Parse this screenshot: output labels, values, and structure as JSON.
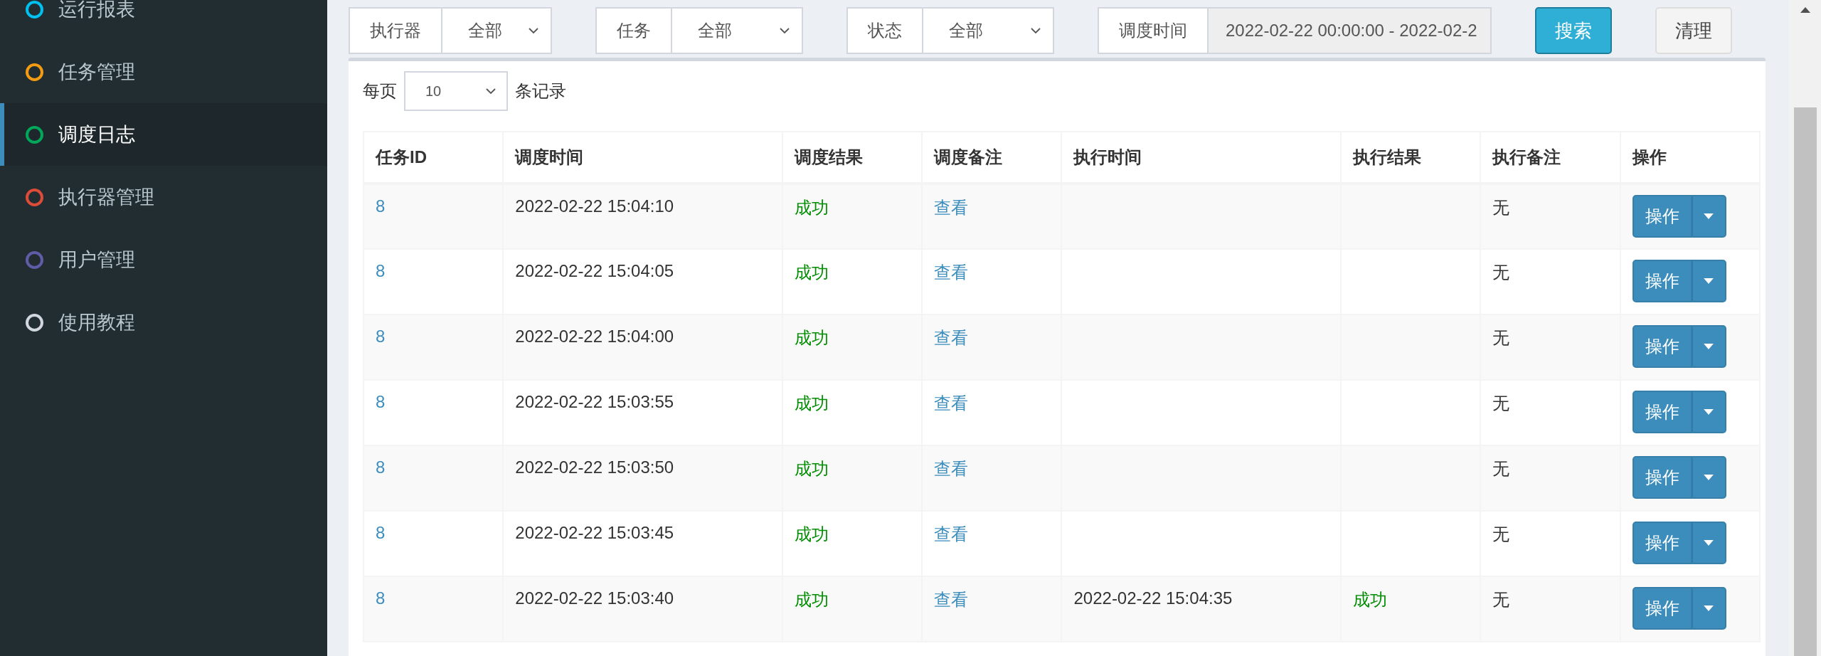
{
  "sidebar": {
    "items": [
      {
        "label": "运行报表",
        "color": "#00c0ef",
        "selected": false
      },
      {
        "label": "任务管理",
        "color": "#f39c12",
        "selected": false
      },
      {
        "label": "调度日志",
        "color": "#00a65a",
        "selected": true
      },
      {
        "label": "执行器管理",
        "color": "#dd4b39",
        "selected": false
      },
      {
        "label": "用户管理",
        "color": "#605ca8",
        "selected": false
      },
      {
        "label": "使用教程",
        "color": "#d2d6de",
        "selected": false
      }
    ]
  },
  "filters": [
    {
      "kind": "select",
      "label": "执行器",
      "value": "全部"
    },
    {
      "kind": "select",
      "label": "任务",
      "value": "全部"
    },
    {
      "kind": "select",
      "label": "状态",
      "value": "全部"
    },
    {
      "kind": "date_range",
      "label": "调度时间",
      "value": "2022-02-22 00:00:00 - 2022-02-2"
    }
  ],
  "buttons": [
    {
      "kind": "primary",
      "label": "搜索"
    },
    {
      "kind": "default",
      "label": "清理"
    }
  ],
  "page_size": {
    "prefix": "每页",
    "value": "10",
    "suffix": "条记录"
  },
  "table": {
    "columns": [
      "任务ID",
      "调度时间",
      "调度结果",
      "调度备注",
      "执行时间",
      "执行结果",
      "执行备注",
      "操作"
    ],
    "rows": [
      {
        "task_id": "8",
        "trigger_time": "2022-02-22 15:04:10",
        "trigger_result": "成功",
        "trigger_msg": "查看",
        "handle_time": "",
        "handle_result": "",
        "handle_msg": "无",
        "action": "操作"
      },
      {
        "task_id": "8",
        "trigger_time": "2022-02-22 15:04:05",
        "trigger_result": "成功",
        "trigger_msg": "查看",
        "handle_time": "",
        "handle_result": "",
        "handle_msg": "无",
        "action": "操作"
      },
      {
        "task_id": "8",
        "trigger_time": "2022-02-22 15:04:00",
        "trigger_result": "成功",
        "trigger_msg": "查看",
        "handle_time": "",
        "handle_result": "",
        "handle_msg": "无",
        "action": "操作"
      },
      {
        "task_id": "8",
        "trigger_time": "2022-02-22 15:03:55",
        "trigger_result": "成功",
        "trigger_msg": "查看",
        "handle_time": "",
        "handle_result": "",
        "handle_msg": "无",
        "action": "操作"
      },
      {
        "task_id": "8",
        "trigger_time": "2022-02-22 15:03:50",
        "trigger_result": "成功",
        "trigger_msg": "查看",
        "handle_time": "",
        "handle_result": "",
        "handle_msg": "无",
        "action": "操作"
      },
      {
        "task_id": "8",
        "trigger_time": "2022-02-22 15:03:45",
        "trigger_result": "成功",
        "trigger_msg": "查看",
        "handle_time": "",
        "handle_result": "",
        "handle_msg": "无",
        "action": "操作"
      },
      {
        "task_id": "8",
        "trigger_time": "2022-02-22 15:03:40",
        "trigger_result": "成功",
        "trigger_msg": "查看",
        "handle_time": "2022-02-22 15:04:35",
        "handle_result": "成功",
        "handle_msg": "无",
        "action": "操作"
      }
    ]
  }
}
